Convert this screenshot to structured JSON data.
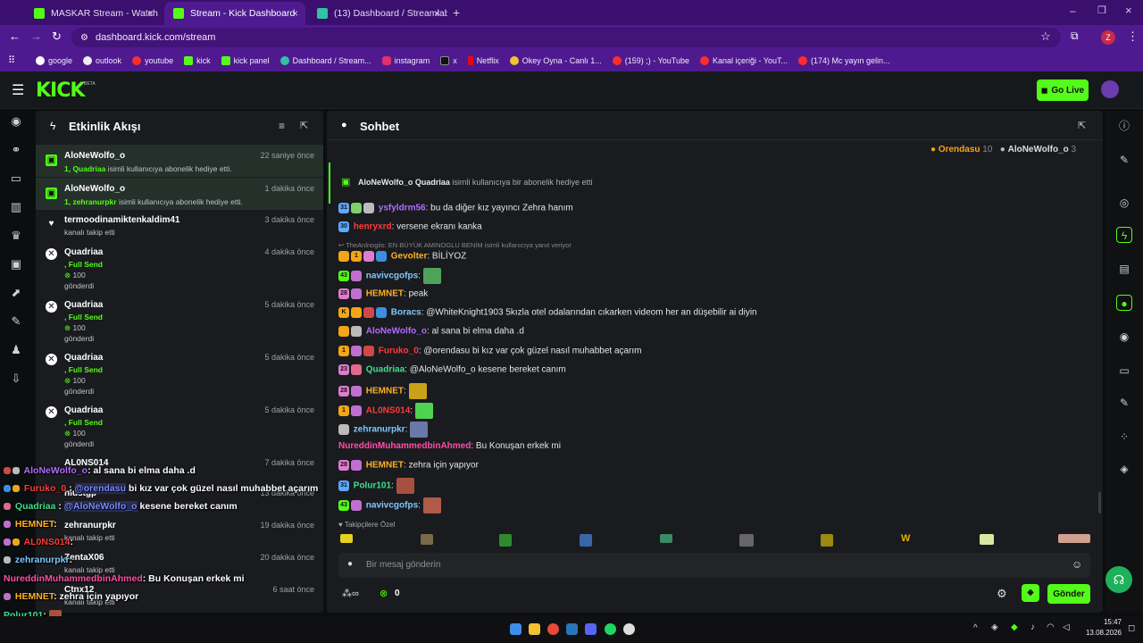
{
  "browser": {
    "tabs": [
      {
        "label": "MASKAR Stream - Watch Live o",
        "active": false
      },
      {
        "label": "Stream - Kick Dashboard",
        "active": true
      },
      {
        "label": "(13) Dashboard / Streamlabs",
        "active": false
      }
    ],
    "url": "dashboard.kick.com/stream",
    "profile_initial": "Z",
    "bookmarks": [
      "google",
      "outlook",
      "youtube",
      "kick",
      "kick panel",
      "Dashboard / Stream...",
      "instagram",
      "x",
      "Netflix",
      "Okey Oyna - Canlı 1...",
      "(159) ;) - YouTube",
      "Kanal içeriği - YouT...",
      "(174) Mc yayın gelin..."
    ]
  },
  "header": {
    "logo": "KICK",
    "beta": "BETA",
    "go_live_label": "Go Live"
  },
  "activity": {
    "title": "Etkinlik Akışı",
    "items": [
      {
        "user": "AloNeWolfo_o",
        "sub_prefix": "1, Quadriaa",
        "sub_text": " isimli kullanıcıya abonelik hediye etti.",
        "time": "22 saniye önce"
      },
      {
        "user": "AloNeWolfo_o",
        "sub_prefix": "1, zehranurpkr",
        "sub_text": " isimli kullanıcıya abonelik hediye etti.",
        "time": "1 dakika önce"
      },
      {
        "user": "termoodinamiktenkaldim41",
        "sub_text": "kanalı takip etti",
        "time": "3 dakika önce"
      },
      {
        "user": "Quadriaa",
        "send": ", Full Send",
        "amount": "100",
        "sent": "gönderdi",
        "time": "4 dakika önce"
      },
      {
        "user": "Quadriaa",
        "send": ", Full Send",
        "amount": "100",
        "sent": "gönderdi",
        "time": "5 dakika önce"
      },
      {
        "user": "Quadriaa",
        "send": ", Full Send",
        "amount": "100",
        "sent": "gönderdi",
        "time": "5 dakika önce"
      },
      {
        "user": "Quadriaa",
        "send": ", Full Send",
        "amount": "100",
        "sent": "gönderdi",
        "time": "5 dakika önce"
      },
      {
        "user": "AL0NS014",
        "sub_text": "",
        "time": "7 dakika önce"
      },
      {
        "user": "hiustgp",
        "sub_text": "",
        "time": "13 dakika önce"
      },
      {
        "user": "zehranurpkr",
        "sub_text": "kanalı takip etti",
        "time": "19 dakika önce"
      },
      {
        "user": "ZentaX06",
        "sub_text": "kanalı takip etti",
        "time": "20 dakika önce"
      },
      {
        "user": "Ctnx12",
        "sub_text": "kanalı takip etti",
        "time": "6 saat önce"
      }
    ]
  },
  "chat": {
    "title": "Sohbet",
    "top_gifters": [
      {
        "name": "Orendasu",
        "count": "10"
      },
      {
        "name": "AloNeWolfo_o",
        "count": "3"
      }
    ],
    "gift_banner": {
      "user": "AloNeWolfo_o",
      "target": "Quadriaa",
      "text": "isimli kullanıcıya bir abonelik hediye etti"
    },
    "reply_notice": "TheAnlnogiis: EN BÜYÜK AMINOGLU BENİM isimli kullanıcıya yanıt veriyor",
    "messages": [
      {
        "user": "ysfyldrm56",
        "color": "#b06cff",
        "text": ": bu da diğer kız yayıncı Zehra hanım"
      },
      {
        "user": "henryxrd",
        "color": "#ff3b3b",
        "text": ": versene ekranı kanka"
      },
      {
        "user": "Gevolter",
        "color": "#ffb020",
        "text": ": BİLİYOZ"
      },
      {
        "user": "navivcgofps",
        "color": "#7fc8ff",
        "text": ":"
      },
      {
        "user": "HEMNET",
        "color": "#ffb020",
        "text": ": peak"
      },
      {
        "user": "Boracs",
        "color": "#7fc8ff",
        "text": ": @WhiteKnight1903 5kızla otel odalarından cıkarken videom her an düşebilir ai diyin"
      },
      {
        "user": "AloNeWolfo_o",
        "color": "#b06cff",
        "text": ": al sana bi elma daha .d"
      },
      {
        "user": "Furuko_0",
        "color": "#ff3b3b",
        "text": ": @orendasu bi kız var çok güzel nasıl muhabbet açarım"
      },
      {
        "user": "Quadriaa",
        "color": "#3ee08a",
        "text": ": @AloNeWolfo_o kesene bereket canım"
      },
      {
        "user": "HEMNET",
        "color": "#ffb020",
        "text": ":"
      },
      {
        "user": "AL0NS014",
        "color": "#ff3b3b",
        "text": ":"
      },
      {
        "user": "zehranurpkr",
        "color": "#7fc8ff",
        "text": ":"
      },
      {
        "user": "NureddinMuhammedbinAhmed",
        "color": "#ff4fa8",
        "text": ": Bu Konuşan erkek mi"
      },
      {
        "user": "HEMNET",
        "color": "#ffb020",
        "text": ": zehra için yapıyor"
      },
      {
        "user": "Polur101",
        "color": "#3ee08a",
        "text": ":"
      },
      {
        "user": "navivcgofps",
        "color": "#7fc8ff",
        "text": ":"
      }
    ],
    "followers_only": "Takipçilere Özel",
    "input_placeholder": "Bir mesaj gönderin",
    "kicks_count": "0",
    "send_label": "Gönder"
  },
  "overlay": {
    "lines": [
      {
        "user": "AloNeWolfo_o",
        "color": "#b06cff",
        "text": ": al sana bi elma daha .d"
      },
      {
        "user": "Furuko_0",
        "color": "#ff3b3b",
        "mention": "@orendasu",
        "text": " bi kız var çok güzel nasıl muhabbet açarım"
      },
      {
        "user": "Quadriaa",
        "color": "#3ee08a",
        "mention": "@AloNeWolfo_o",
        "text": " kesene bereket canım"
      },
      {
        "user": "HEMNET",
        "color": "#ffb020",
        "text": ":"
      },
      {
        "user": "AL0NS014",
        "color": "#ff3b3b",
        "text": ":"
      },
      {
        "user": "zehranurpkr",
        "color": "#7fc8ff",
        "text": ":"
      },
      {
        "user": "NureddinMuhammedbinAhmed",
        "color": "#ff4fa8",
        "text": ": Bu Konuşan erkek mi"
      },
      {
        "user": "HEMNET",
        "color": "#ffb020",
        "text": ": zehra için yapıyor"
      },
      {
        "user": "Polur101",
        "color": "#3ee08a",
        "text": ":"
      },
      {
        "user": "navivcgofps",
        "color": "#7fc8ff",
        "text": ":"
      }
    ]
  },
  "taskbar": {
    "time": "15:47",
    "date": "13.08.2026"
  }
}
